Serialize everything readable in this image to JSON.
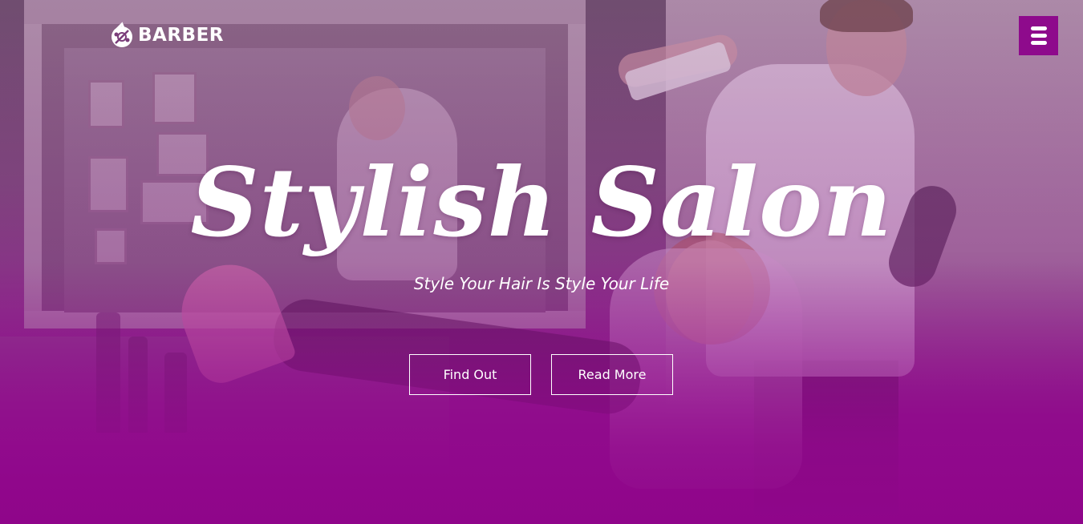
{
  "brand": {
    "logo_text": "BARBER",
    "logo_icon": "barber-badge-icon"
  },
  "nav": {
    "menu_icon": "hamburger-menu-icon"
  },
  "hero": {
    "title": "Stylish Salon",
    "tagline": "Style Your Hair Is Style Your Life",
    "buttons": [
      {
        "label": "Find Out"
      },
      {
        "label": "Read More"
      }
    ]
  },
  "colors": {
    "accent": "#8e0a8c",
    "text": "#ffffff",
    "overlay_bottom": "#8f058a"
  }
}
